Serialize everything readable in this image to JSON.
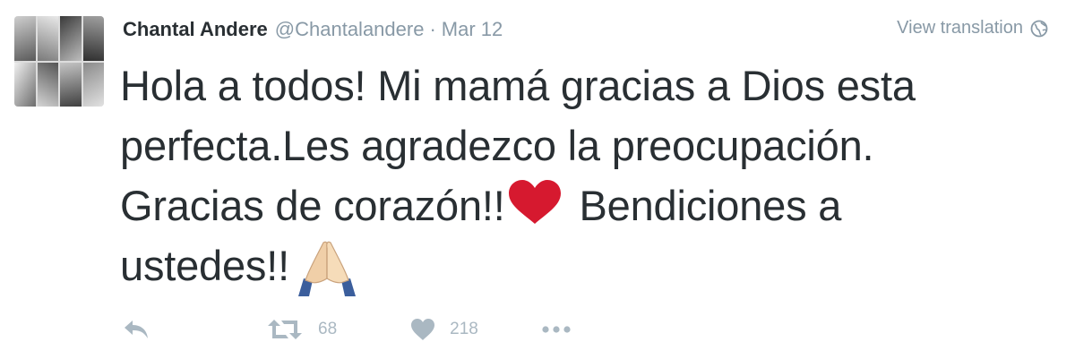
{
  "tweet": {
    "author_name": "Chantal Andere",
    "handle": "@Chantalandere",
    "separator": "·",
    "date": "Mar 12",
    "translate_label": "View translation",
    "lines": [
      "Hola a todos! Mi mamá gracias a Dios esta",
      "perfecta.Les agradezco la preocupación.",
      "Gracias de corazón!!",
      " Bendiciones a",
      "ustedes!!"
    ],
    "emojis": [
      "heart-emoji",
      "praying-hands-emoji"
    ],
    "retweet_count": "68",
    "like_count": "218"
  },
  "icons": {
    "reply": "reply-icon",
    "retweet": "retweet-icon",
    "like": "heart-icon",
    "more": "more-icon",
    "globe": "globe-icon"
  },
  "colors": {
    "text": "#292f33",
    "muted": "#8899a6",
    "action": "#aab8c2",
    "heart_emoji": "#d6192f"
  }
}
